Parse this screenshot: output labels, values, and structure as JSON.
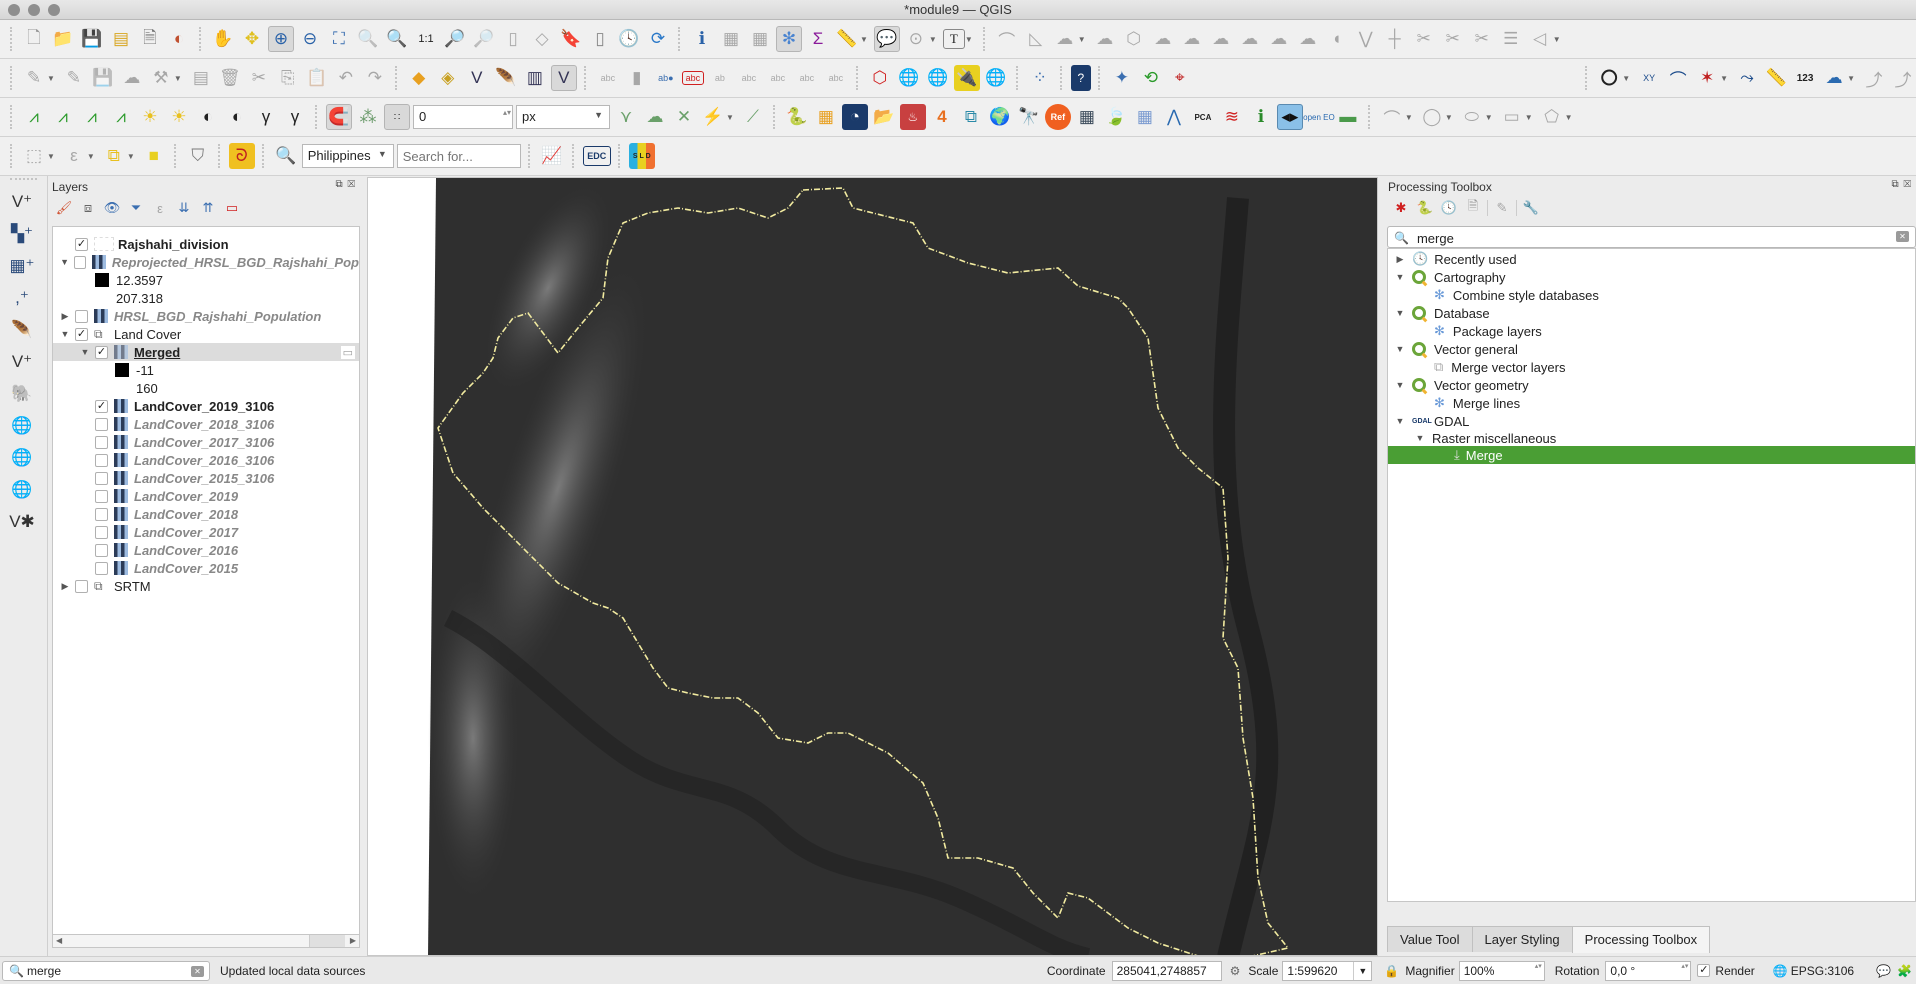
{
  "window": {
    "title": "*module9 — QGIS"
  },
  "toolbar": {
    "snapping_tolerance_value": "0",
    "snapping_unit": "px",
    "geocoder_country": "Philippines",
    "geocoder_search_placeholder": "Search for...",
    "row1_icons": [
      "new-project-icon",
      "open-project-icon",
      "save-project-icon",
      "new-print-layout-icon",
      "layout-manager-icon",
      "style-manager-icon",
      "pan-icon",
      "pan-to-selection-icon",
      "zoom-in-icon",
      "zoom-out-icon",
      "zoom-full-icon",
      "zoom-to-selection-icon",
      "zoom-to-layer-icon",
      "zoom-native-icon",
      "zoom-last-icon",
      "zoom-next-icon",
      "new-map-view-icon",
      "new-3d-map-icon",
      "new-bookmark-icon",
      "show-bookmarks-icon",
      "temporal-controller-icon",
      "refresh-icon",
      "identify-icon",
      "open-attribute-table-icon",
      "field-calculator-icon",
      "processing-toolbox-icon",
      "statistical-summary-icon",
      "measure-icon",
      "map-tips-icon",
      "select-features-icon",
      "text-annotation-icon"
    ],
    "row2_labels": {
      "xy": "XY",
      "num": "123",
      "open_eo": "open EO",
      "ref": "Ref",
      "pca": "PCA",
      "edc": "EDC",
      "sld": "S L D"
    }
  },
  "layers_panel": {
    "title": "Layers",
    "items": [
      {
        "name": "Rajshahi_division",
        "checked": true,
        "style": "bold",
        "expander": ""
      },
      {
        "name": "Reprojected_HRSL_BGD_Rajshahi_Pop",
        "checked": false,
        "style": "italic",
        "expander": "open"
      },
      {
        "legend_min": "12.3597",
        "legend_max": "207.318"
      },
      {
        "name": "HRSL_BGD_Rajshahi_Population",
        "checked": false,
        "style": "italic",
        "expander": "closed"
      },
      {
        "name": "Land Cover",
        "checked": true,
        "style": "group",
        "expander": "open"
      },
      {
        "name": "Merged",
        "checked": true,
        "style": "selected",
        "expander": "open",
        "legend_min": "-11",
        "legend_max": "160"
      },
      {
        "name": "LandCover_2019_3106",
        "checked": true,
        "style": "bold"
      },
      {
        "name": "LandCover_2018_3106",
        "checked": false,
        "style": "italic"
      },
      {
        "name": "LandCover_2017_3106",
        "checked": false,
        "style": "italic"
      },
      {
        "name": "LandCover_2016_3106",
        "checked": false,
        "style": "italic"
      },
      {
        "name": "LandCover_2015_3106",
        "checked": false,
        "style": "italic"
      },
      {
        "name": "LandCover_2019",
        "checked": false,
        "style": "italic"
      },
      {
        "name": "LandCover_2018",
        "checked": false,
        "style": "italic"
      },
      {
        "name": "LandCover_2017",
        "checked": false,
        "style": "italic"
      },
      {
        "name": "LandCover_2016",
        "checked": false,
        "style": "italic"
      },
      {
        "name": "LandCover_2015",
        "checked": false,
        "style": "italic"
      },
      {
        "name": "SRTM",
        "checked": false,
        "style": "group",
        "expander": "closed"
      }
    ]
  },
  "processing_toolbox": {
    "title": "Processing Toolbox",
    "search_value": "merge",
    "tree": [
      {
        "label": "Recently used",
        "level": 0,
        "expander": "closed",
        "icon": "clock-icon"
      },
      {
        "label": "Cartography",
        "level": 0,
        "expander": "open",
        "icon": "qgis-icon"
      },
      {
        "label": "Combine style databases",
        "level": 1,
        "icon": "gear-icon"
      },
      {
        "label": "Database",
        "level": 0,
        "expander": "open",
        "icon": "qgis-icon"
      },
      {
        "label": "Package layers",
        "level": 1,
        "icon": "gear-icon"
      },
      {
        "label": "Vector general",
        "level": 0,
        "expander": "open",
        "icon": "qgis-icon"
      },
      {
        "label": "Merge vector layers",
        "level": 1,
        "icon": "merge-layers-icon"
      },
      {
        "label": "Vector geometry",
        "level": 0,
        "expander": "open",
        "icon": "qgis-icon"
      },
      {
        "label": "Merge lines",
        "level": 1,
        "icon": "gear-icon"
      },
      {
        "label": "GDAL",
        "level": 0,
        "expander": "open",
        "icon": "gdal-icon"
      },
      {
        "label": "Raster miscellaneous",
        "level": 1,
        "expander": "open"
      },
      {
        "label": "Merge",
        "level": 2,
        "icon": "gdal-merge-icon",
        "selected": true
      }
    ],
    "tabs": [
      "Value Tool",
      "Layer Styling",
      "Processing Toolbox"
    ],
    "active_tab": "Processing Toolbox"
  },
  "statusbar": {
    "locator_value": "merge",
    "message": "Updated local data sources",
    "coordinate_label": "Coordinate",
    "coordinate_value": "285041,2748857",
    "scale_label": "Scale",
    "scale_value": "1:599620",
    "magnifier_label": "Magnifier",
    "magnifier_value": "100%",
    "rotation_label": "Rotation",
    "rotation_value": "0,0 °",
    "render_label": "Render",
    "render_checked": true,
    "crs": "EPSG:3106"
  },
  "colors": {
    "accent_selected": "#4a9e34",
    "boundary": "#f2eba0"
  }
}
